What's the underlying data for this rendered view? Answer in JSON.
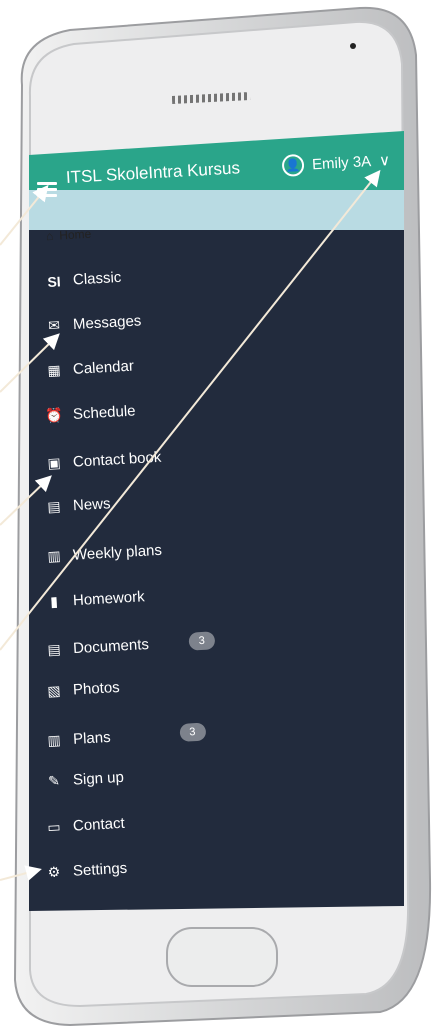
{
  "header": {
    "title": "ITSL SkoleIntra Kursus",
    "user": "Emily 3A"
  },
  "nav": {
    "home": "Home",
    "items": [
      {
        "label": "Classic",
        "icon": "si-logo-icon",
        "badge": ""
      },
      {
        "label": "Messages",
        "icon": "envelope-icon",
        "badge": ""
      },
      {
        "label": "Calendar",
        "icon": "calendar-icon",
        "badge": ""
      },
      {
        "label": "Schedule",
        "icon": "alarm-clock-icon",
        "badge": ""
      },
      {
        "label": "Contact book",
        "icon": "contact-book-icon",
        "badge": ""
      },
      {
        "label": "News",
        "icon": "news-icon",
        "badge": ""
      },
      {
        "label": "Weekly plans",
        "icon": "weekly-plan-icon",
        "badge": ""
      },
      {
        "label": "Homework",
        "icon": "homework-icon",
        "badge": ""
      },
      {
        "label": "Documents",
        "icon": "document-icon",
        "badge": "3"
      },
      {
        "label": "Photos",
        "icon": "photos-icon",
        "badge": ""
      },
      {
        "label": "Plans",
        "icon": "clipboard-icon",
        "badge": "3"
      },
      {
        "label": "Sign up",
        "icon": "signup-icon",
        "badge": ""
      },
      {
        "label": "Contact",
        "icon": "contact-icon",
        "badge": ""
      },
      {
        "label": "Settings",
        "icon": "gear-icon",
        "badge": ""
      }
    ]
  },
  "colors": {
    "header_bg": "#2aa58a",
    "subheader_bg": "#b9dbe3",
    "menu_bg": "#222b3d",
    "badge_bg": "#7d828c"
  }
}
